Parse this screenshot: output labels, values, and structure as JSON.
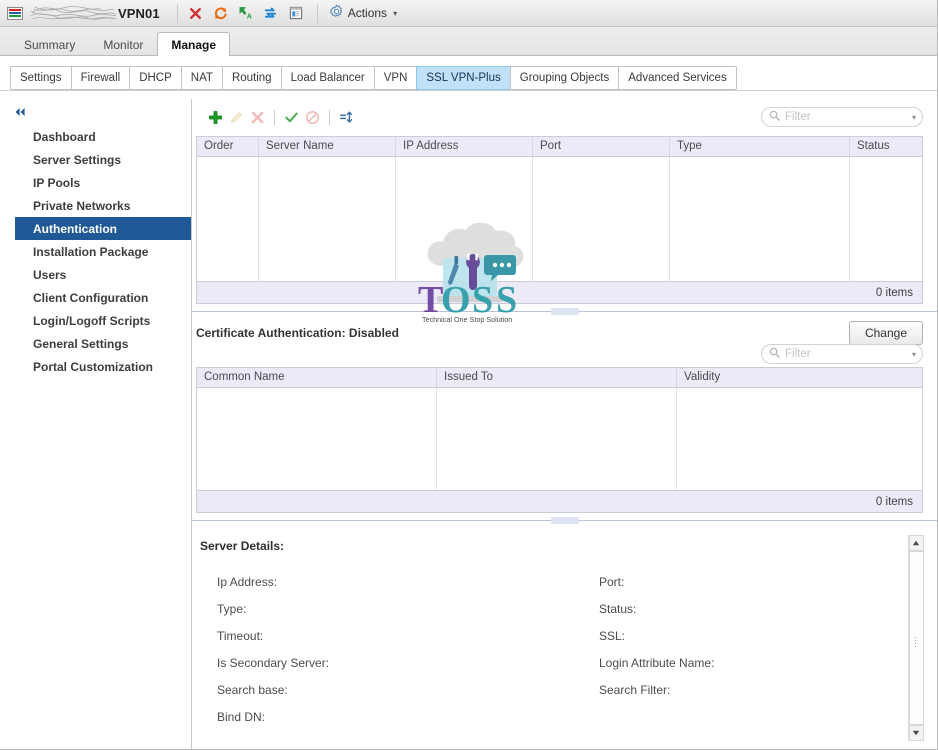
{
  "titlebar": {
    "vm_name": "VPN01",
    "redacted_label": "redacted-hostname",
    "icons": [
      {
        "name": "power-off-icon",
        "label": "Power Off"
      },
      {
        "name": "restart-icon",
        "label": "Restart"
      },
      {
        "name": "migrate-icon",
        "label": "Migrate"
      },
      {
        "name": "sync-icon",
        "label": "Sync"
      },
      {
        "name": "console-icon",
        "label": "Console"
      }
    ],
    "actions_label": "Actions",
    "actions_caret": "▾"
  },
  "main_tabs": [
    {
      "label": "Summary",
      "active": false
    },
    {
      "label": "Monitor",
      "active": false
    },
    {
      "label": "Manage",
      "active": true
    }
  ],
  "sub_tabs": [
    {
      "label": "Settings",
      "active": false
    },
    {
      "label": "Firewall",
      "active": false
    },
    {
      "label": "DHCP",
      "active": false
    },
    {
      "label": "NAT",
      "active": false
    },
    {
      "label": "Routing",
      "active": false
    },
    {
      "label": "Load Balancer",
      "active": false
    },
    {
      "label": "VPN",
      "active": false
    },
    {
      "label": "SSL VPN-Plus",
      "active": true
    },
    {
      "label": "Grouping Objects",
      "active": false
    },
    {
      "label": "Advanced Services",
      "active": false
    }
  ],
  "sidebar": {
    "collapse_icon": "collapse-left-icon",
    "items": [
      {
        "label": "Dashboard",
        "active": false
      },
      {
        "label": "Server Settings",
        "active": false
      },
      {
        "label": "IP Pools",
        "active": false
      },
      {
        "label": "Private Networks",
        "active": false
      },
      {
        "label": "Authentication",
        "active": true
      },
      {
        "label": "Installation Package",
        "active": false
      },
      {
        "label": "Users",
        "active": false
      },
      {
        "label": "Client Configuration",
        "active": false
      },
      {
        "label": "Login/Logoff Scripts",
        "active": false
      },
      {
        "label": "General Settings",
        "active": false
      },
      {
        "label": "Portal Customization",
        "active": false
      }
    ]
  },
  "toolbar": {
    "buttons": [
      {
        "name": "add-button",
        "icon": "plus-icon",
        "enabled": true
      },
      {
        "name": "edit-button",
        "icon": "pencil-icon",
        "enabled": false
      },
      {
        "name": "delete-button",
        "icon": "x-icon",
        "enabled": false
      },
      {
        "name": "enable-button",
        "icon": "check-icon",
        "enabled": true
      },
      {
        "name": "disable-button",
        "icon": "no-entry-icon",
        "enabled": false
      },
      {
        "name": "reorder-button",
        "icon": "sort-arrows-icon",
        "enabled": true
      }
    ]
  },
  "filter": {
    "placeholder": "Filter",
    "value": "",
    "search_icon": "search-icon",
    "caret": "▾"
  },
  "auth_servers_grid": {
    "columns": [
      "Order",
      "Server Name",
      "IP Address",
      "Port",
      "Type",
      "Status"
    ],
    "rows": [],
    "footer": "0 items"
  },
  "certificate": {
    "label": "Certificate Authentication: Disabled",
    "change_label": "Change"
  },
  "certificates_grid": {
    "columns": [
      "Common Name",
      "Issued To",
      "Validity"
    ],
    "rows": [],
    "footer": "0 items"
  },
  "server_details": {
    "title": "Server Details:",
    "fields_left": [
      "Ip Address:",
      "Type:",
      "Timeout:",
      "Is Secondary Server:",
      "Search base:",
      "Bind DN:"
    ],
    "fields_right": [
      "Port:",
      "Status:",
      "SSL:",
      "Login Attribute Name:",
      "Search Filter:",
      ""
    ],
    "scroll_up": "▲",
    "scroll_down": "▼"
  },
  "watermark": {
    "brand": "TOSS",
    "tagline": "Technical One Stop Solution"
  },
  "colors": {
    "accent_selected_nav": "#1f5a96",
    "accent_active_tab": "#bfe2f9",
    "grid_header": "#eceaf6",
    "brand_purple": "#6b3f9e",
    "brand_teal": "#2a9aa8"
  }
}
